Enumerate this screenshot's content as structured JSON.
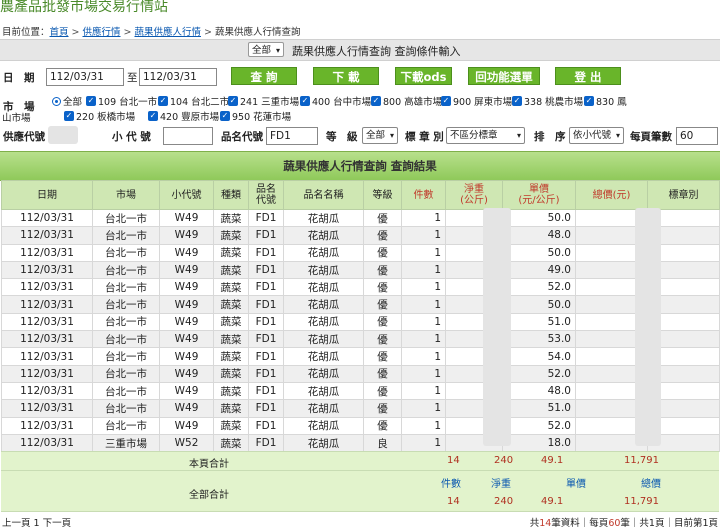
{
  "site_title": "農產品批發市場交易行情站",
  "breadcrumb": {
    "prefix": "目前位置：",
    "links": [
      "首頁",
      "供應行情",
      "蔬果供應人行情"
    ],
    "current": "蔬果供應人行情查詢"
  },
  "topbar": {
    "mode_value": "全部",
    "title": "蔬果供應人行情查詢 查詢條件輸入"
  },
  "form": {
    "date_label": "日　期",
    "date_from": "112/03/31",
    "date_to_sep": "至",
    "date_to": "112/03/31",
    "buttons": [
      "查 詢",
      "下 載",
      "下載ods",
      "回功能選單",
      "登 出"
    ],
    "market_label": "市　場",
    "market_all": "全部",
    "markets_row1": [
      "109 台北一市",
      "104 台北二市",
      "241 三重市場",
      "400 台中市場",
      "800 高雄市場",
      "900 屏東市場",
      "338 桃農市場",
      "830 鳳"
    ],
    "markets_row2_prefix": "山市場",
    "markets_row2": [
      "220 板橋市場",
      "420 豐原市場",
      "950 花蓮市場"
    ],
    "supplier_label": "供應代號",
    "sub_code_label": "小 代 號",
    "product_code_label": "品名代號",
    "product_code_value": "FD1",
    "grade_label": "等　級",
    "grade_value": "全部",
    "mark_label": "標 章 別",
    "mark_value": "不區分標章",
    "sort_label": "排　序",
    "sort_value": "依小代號",
    "page_size_label": "每頁筆數",
    "page_size_value": "60"
  },
  "result": {
    "title": "蔬果供應人行情查詢 查詢結果",
    "headers": [
      "日期",
      "市場",
      "小代號",
      "種類",
      "品名\n代號",
      "品名名稱",
      "等級",
      "件數",
      "淨重\n(公斤)",
      "單價\n(元/公斤)",
      "總價(元)",
      "標章別"
    ],
    "rows": [
      [
        "112/03/31",
        "台北一市",
        "W49",
        "蔬菜",
        "FD1",
        "花胡瓜",
        "優",
        "1",
        "50.0"
      ],
      [
        "112/03/31",
        "台北一市",
        "W49",
        "蔬菜",
        "FD1",
        "花胡瓜",
        "優",
        "1",
        "48.0"
      ],
      [
        "112/03/31",
        "台北一市",
        "W49",
        "蔬菜",
        "FD1",
        "花胡瓜",
        "優",
        "1",
        "50.0"
      ],
      [
        "112/03/31",
        "台北一市",
        "W49",
        "蔬菜",
        "FD1",
        "花胡瓜",
        "優",
        "1",
        "49.0"
      ],
      [
        "112/03/31",
        "台北一市",
        "W49",
        "蔬菜",
        "FD1",
        "花胡瓜",
        "優",
        "1",
        "52.0"
      ],
      [
        "112/03/31",
        "台北一市",
        "W49",
        "蔬菜",
        "FD1",
        "花胡瓜",
        "優",
        "1",
        "50.0"
      ],
      [
        "112/03/31",
        "台北一市",
        "W49",
        "蔬菜",
        "FD1",
        "花胡瓜",
        "優",
        "1",
        "51.0"
      ],
      [
        "112/03/31",
        "台北一市",
        "W49",
        "蔬菜",
        "FD1",
        "花胡瓜",
        "優",
        "1",
        "53.0"
      ],
      [
        "112/03/31",
        "台北一市",
        "W49",
        "蔬菜",
        "FD1",
        "花胡瓜",
        "優",
        "1",
        "54.0"
      ],
      [
        "112/03/31",
        "台北一市",
        "W49",
        "蔬菜",
        "FD1",
        "花胡瓜",
        "優",
        "1",
        "52.0"
      ],
      [
        "112/03/31",
        "台北一市",
        "W49",
        "蔬菜",
        "FD1",
        "花胡瓜",
        "優",
        "1",
        "48.0"
      ],
      [
        "112/03/31",
        "台北一市",
        "W49",
        "蔬菜",
        "FD1",
        "花胡瓜",
        "優",
        "1",
        "51.0"
      ],
      [
        "112/03/31",
        "台北一市",
        "W49",
        "蔬菜",
        "FD1",
        "花胡瓜",
        "優",
        "1",
        "52.0"
      ],
      [
        "112/03/31",
        "三重市場",
        "W52",
        "蔬菜",
        "FD1",
        "花胡瓜",
        "良",
        "1",
        "18.0"
      ]
    ],
    "page_total": {
      "label": "本頁合計",
      "count": "14",
      "weight": "240",
      "price": "49.1",
      "total": "11,791"
    },
    "grand_total": {
      "label": "全部合計",
      "h_count": "件數",
      "h_weight": "淨重",
      "h_price": "單價",
      "h_total": "總價",
      "count": "14",
      "weight": "240",
      "price": "49.1",
      "total": "11,791"
    }
  },
  "footer": {
    "nav": "上一頁 1 下一頁",
    "info_parts": [
      "共",
      "14",
      "筆資料｜每頁",
      "60",
      "筆｜共1頁｜目前第1頁"
    ]
  }
}
